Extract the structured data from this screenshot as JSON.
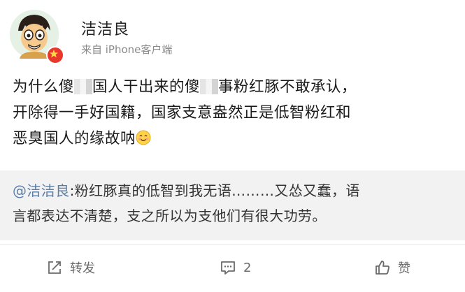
{
  "post": {
    "username": "洁洁良",
    "source": "来自 iPhone客户端",
    "body": {
      "line1_a": "为什么傻",
      "line1_b": "国人干出来的傻",
      "line1_c": "事粉红豚不敢承认，",
      "line2": "开除得一手好国籍，国家支意盎然正是低智粉红和",
      "line3": "恶臭国人的缘故呐"
    }
  },
  "repost": {
    "mention": "@洁洁良",
    "text_line1": ":粉红豚真的低智到我无语………又怂又蠢，语",
    "text_line2": "言都表达不清楚，支之所以为支他们有很大功劳。"
  },
  "actions": {
    "repost_label": "转发",
    "comment_count": "2",
    "like_label": "赞"
  },
  "colors": {
    "mention": "#5b7ea8",
    "vip_badge": "#e8372b",
    "action_text": "#6b6b6b"
  }
}
